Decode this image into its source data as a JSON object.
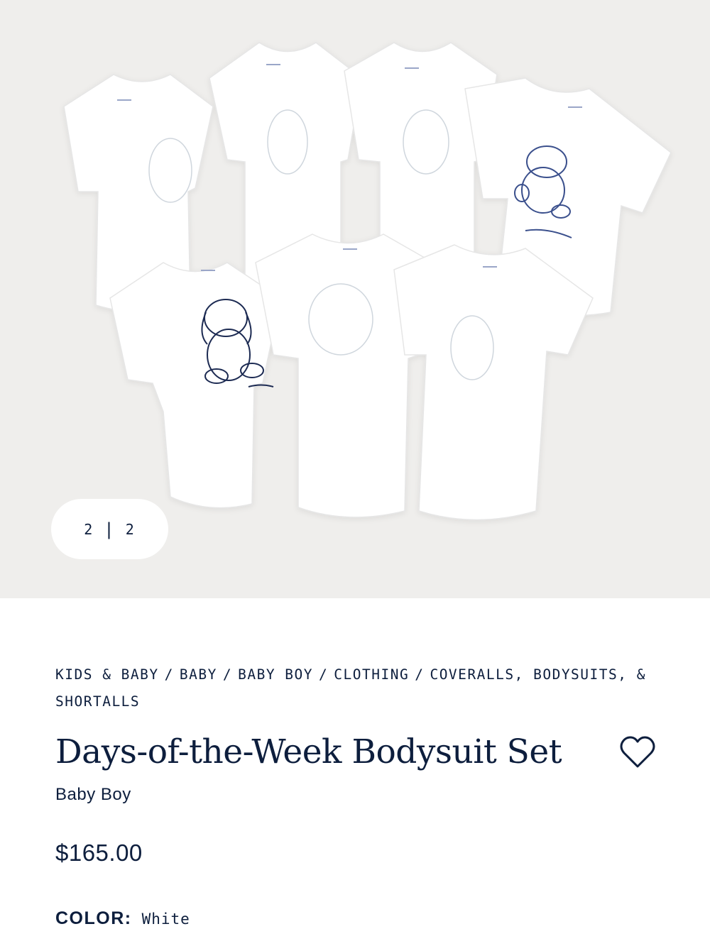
{
  "gallery": {
    "image_alt": "Seven white short-sleeve bodysuits with embroidered plush animals",
    "pager": {
      "current": "2",
      "separator": "|",
      "total": "2"
    }
  },
  "breadcrumb": {
    "items": [
      "KIDS & BABY",
      "BABY",
      "BABY BOY",
      "CLOTHING",
      "COVERALLS, BODYSUITS, & SHORTALLS"
    ],
    "separator": "/"
  },
  "product": {
    "title": "Days-of-the-Week Bodysuit Set",
    "subtitle": "Baby Boy",
    "price": "$165.00",
    "color_label": "COLOR:",
    "color_value": "White",
    "favorite_icon": "heart-outline-icon"
  },
  "colors": {
    "text": "#0d1e3d",
    "gallery_bg": "#efeeec",
    "pager_bg": "#ffffff",
    "embroidery": "#1c2a52"
  }
}
